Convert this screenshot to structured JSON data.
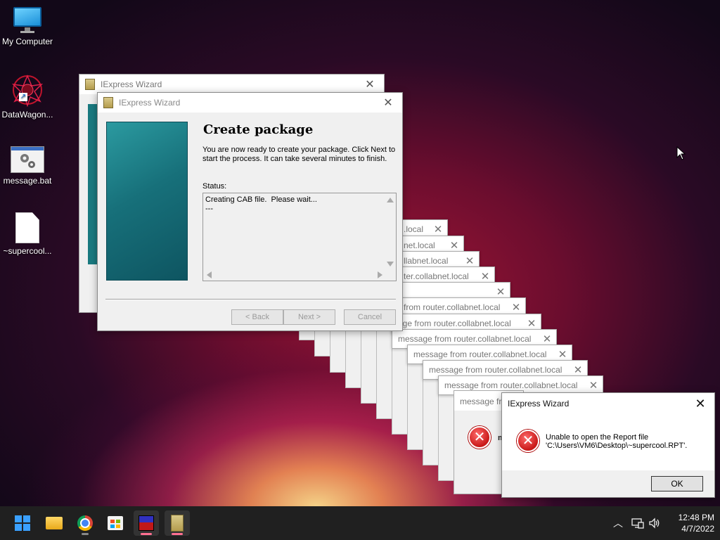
{
  "desktop": {
    "icons": [
      {
        "label": "My Computer"
      },
      {
        "label": "DataWagon..."
      },
      {
        "label": "message.bat"
      },
      {
        "label": "~supercool..."
      }
    ]
  },
  "back_wizard": {
    "title": "IExpress Wizard"
  },
  "wizard": {
    "title": "IExpress Wizard",
    "heading": "Create package",
    "description": "You are now ready to create your package.  Click Next to start the process.  It can take several minutes to finish.",
    "status_label": "Status:",
    "status_text": "Creating CAB file.  Please wait...\n---",
    "back_label": "< Back",
    "next_label": "Next >",
    "cancel_label": "Cancel"
  },
  "messages": [
    {
      "title": ".local"
    },
    {
      "title": "net.local"
    },
    {
      "title": "llabnet.local"
    },
    {
      "title": "ter.collabnet.local"
    },
    {
      "title": ""
    },
    {
      "title": "from router.collabnet.local"
    },
    {
      "title": "age from router.collabnet.local"
    },
    {
      "title": "message from router.collabnet.local"
    },
    {
      "title": "message from router.collabnet.local"
    },
    {
      "title": "message from router.collabnet.local"
    },
    {
      "title": "message from router.collabnet.local"
    },
    {
      "title": "message fr"
    }
  ],
  "error_dialog": {
    "title": "IExpress Wizard",
    "message_line1": "Unable to open the Report file",
    "message_line2": "'C:\\Users\\VM6\\Desktop\\~supercool.RPT'.",
    "ok_label": "OK",
    "behind_fragment": "m"
  },
  "taskbar": {
    "clock_time": "12:48 PM",
    "clock_date": "4/7/2022"
  },
  "colors": {
    "error_red": "#c81818",
    "accent_teal": "#17707a",
    "taskbar_bg": "#202020",
    "active_indicator": "#ff6f91"
  }
}
